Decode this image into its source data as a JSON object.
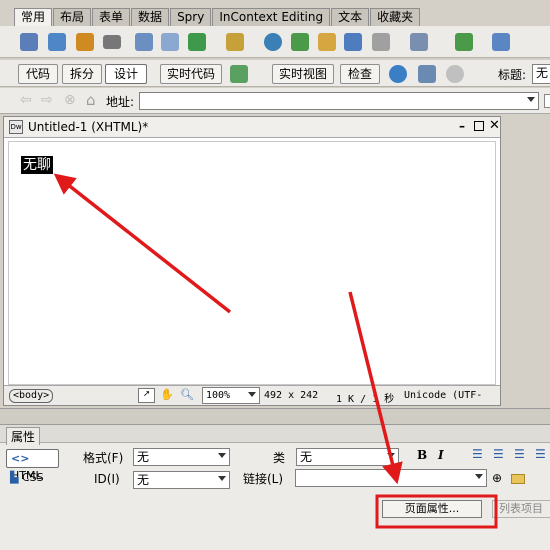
{
  "menu_tabs": [
    "常用",
    "布局",
    "表单",
    "数据",
    "Spry",
    "InContext Editing",
    "文本",
    "收藏夹"
  ],
  "view_buttons": {
    "code": "代码",
    "split": "拆分",
    "design": "设计",
    "live_code": "实时代码",
    "live_view": "实时视图",
    "inspect": "检查"
  },
  "title_label": "标题:",
  "title_value": "无",
  "address_label": "地址:",
  "document": {
    "title": "Untitled-1 (XHTML)*",
    "content": "无聊"
  },
  "status_bar": {
    "tag": "<body>",
    "zoom": "100%",
    "dimensions": "492 x 242",
    "size_info": "1 K / 1 秒",
    "encoding": "Unicode (UTF-"
  },
  "properties": {
    "panel_title": "属性",
    "html_button": "HTML",
    "css_button": "CSS",
    "format_label": "格式(F)",
    "format_value": "无",
    "class_label": "类",
    "class_value": "无",
    "id_label": "ID(I)",
    "id_value": "无",
    "link_label": "链接(L)",
    "page_props_button": "页面属性...",
    "list_item_button": "列表项目"
  }
}
